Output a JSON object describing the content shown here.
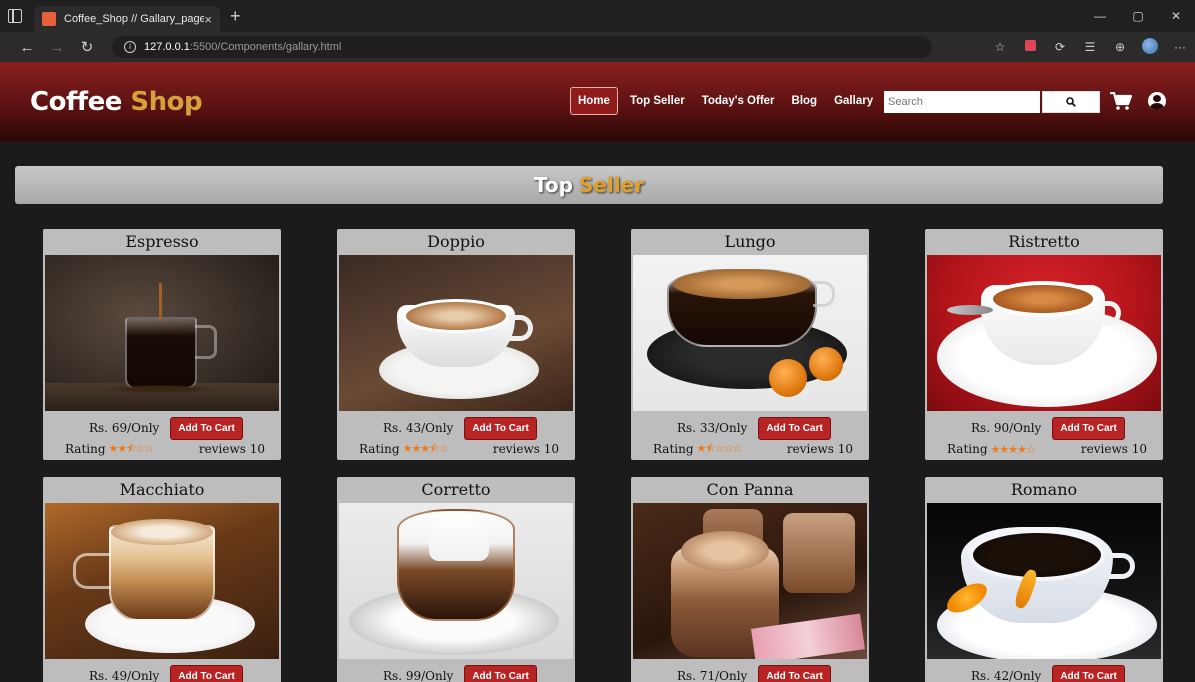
{
  "browser": {
    "tab_title": "Coffee_Shop // Gallary_page",
    "tab_close": "×",
    "new_tab": "+",
    "url_host": "127.0.0.1",
    "url_path": ":5500/Components/gallary.html"
  },
  "header": {
    "logo_main": "Coffee",
    "logo_accent": "Shop",
    "nav": [
      "Home",
      "Top Seller",
      "Today's Offer",
      "Blog",
      "Gallary"
    ],
    "active_nav": "Home",
    "search_placeholder": "Search"
  },
  "section": {
    "title_main": "Top",
    "title_accent": "Seller"
  },
  "add_to_cart_label": "Add To Cart",
  "rating_label": "Rating",
  "products": [
    {
      "name": "Espresso",
      "price": "Rs. 69/Only",
      "rating": 2.5,
      "reviews": "reviews 10"
    },
    {
      "name": "Doppio",
      "price": "Rs. 43/Only",
      "rating": 3.5,
      "reviews": "reviews 10"
    },
    {
      "name": "Lungo",
      "price": "Rs. 33/Only",
      "rating": 1.5,
      "reviews": "reviews 10"
    },
    {
      "name": "Ristretto",
      "price": "Rs. 90/Only",
      "rating": 4,
      "reviews": "reviews 10"
    },
    {
      "name": "Macchiato",
      "price": "Rs. 49/Only",
      "rating": null,
      "reviews": ""
    },
    {
      "name": "Corretto",
      "price": "Rs. 99/Only",
      "rating": null,
      "reviews": ""
    },
    {
      "name": "Con Panna",
      "price": "Rs. 71/Only",
      "rating": null,
      "reviews": ""
    },
    {
      "name": "Romano",
      "price": "Rs. 42/Only",
      "rating": null,
      "reviews": ""
    }
  ],
  "colors": {
    "header_red": "#8a1e1e",
    "accent_gold": "#d6a13a",
    "button_red": "#b82424",
    "star_orange": "#f07a1a",
    "card_grey": "#bdbdbd"
  }
}
